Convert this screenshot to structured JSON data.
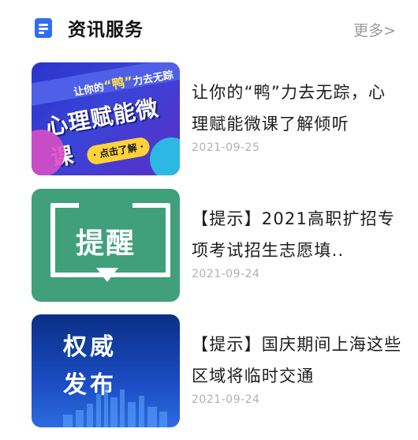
{
  "header": {
    "title": "资讯服务",
    "more": "更多>",
    "icon": "document-icon",
    "accent": "#2f6df6"
  },
  "news": [
    {
      "title": "让你的“鸭”力去无踪，心理赋能微课了解倾听",
      "date": "2021-09-25",
      "thumb": {
        "small_pre": "让你的",
        "small_highlight": "“鸭”",
        "small_post": "力去无踪",
        "big": "心理赋能微课",
        "button": "· 点击了解 ·"
      }
    },
    {
      "title": "【提示】2021高职扩招专项考试招生志愿填..",
      "date": "2021-09-24",
      "thumb": {
        "word": "提醒"
      }
    },
    {
      "title": "【提示】国庆期间上海这些区域将临时交通",
      "date": "2021-09-24",
      "thumb": {
        "line1": "权威",
        "line2": "发布"
      }
    }
  ]
}
